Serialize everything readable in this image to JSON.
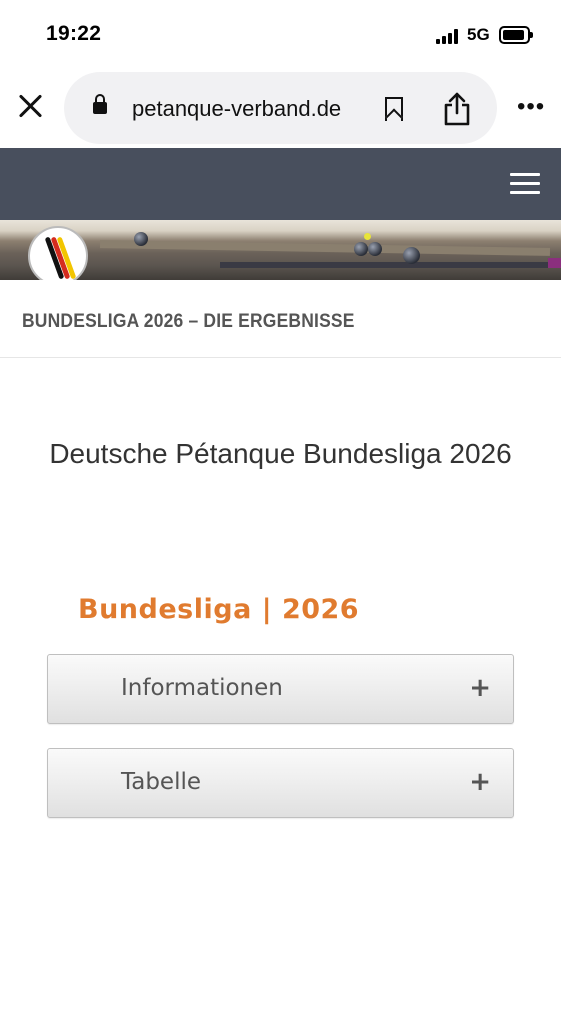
{
  "status_bar": {
    "time": "19:22",
    "network": "5G"
  },
  "browser": {
    "url": "petanque-verband.de"
  },
  "page": {
    "title": "BUNDESLIGA 2026 – DIE ERGEBNISSE",
    "heading": "Deutsche Pétanque Bundesliga 2026",
    "section_title": "Bundesliga | 2026"
  },
  "accordion": {
    "items": [
      {
        "label": "Informationen",
        "toggle": "+"
      },
      {
        "label": "Tabelle",
        "toggle": "+"
      }
    ]
  },
  "icons": {
    "close": "close-icon",
    "lock": "lock-icon",
    "bookmark": "bookmark-icon",
    "share": "share-icon",
    "more": "more-icon",
    "menu": "hamburger-menu-icon"
  },
  "colors": {
    "nav_background": "#484f5d",
    "section_title": "#e07b2f"
  }
}
